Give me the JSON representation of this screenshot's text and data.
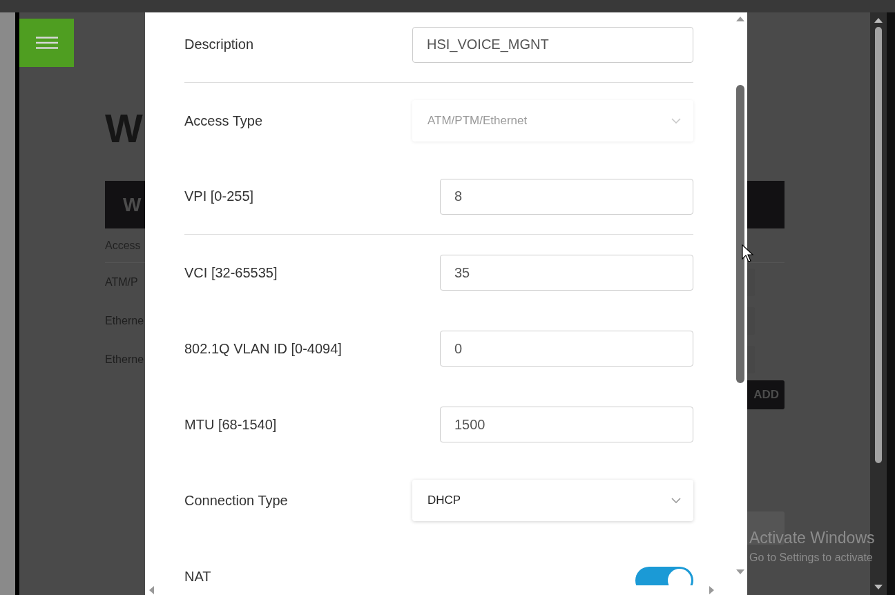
{
  "background_page": {
    "title": "W",
    "panel_title": "W",
    "table": {
      "header": "Access",
      "rows": [
        "ATM/P",
        "Etherne",
        "Etherne"
      ]
    },
    "add_button": "ADD"
  },
  "modal": {
    "fields": [
      {
        "kind": "text",
        "label": "Description",
        "value": "HSI_VOICE_MGNT",
        "divider_after": true
      },
      {
        "kind": "select",
        "label": "Access Type",
        "value": "ATM/PTM/Ethernet",
        "disabled": true,
        "divider_after": false
      },
      {
        "kind": "number",
        "label": "VPI [0-255]",
        "value": "8",
        "divider_after": true
      },
      {
        "kind": "number",
        "label": "VCI [32-65535]",
        "value": "35",
        "divider_after": false
      },
      {
        "kind": "number",
        "label": "802.1Q VLAN ID [0-4094]",
        "value": "0",
        "divider_after": false
      },
      {
        "kind": "number",
        "label": "MTU [68-1540]",
        "value": "1500",
        "divider_after": false
      },
      {
        "kind": "select",
        "label": "Connection Type",
        "value": "DHCP",
        "disabled": false,
        "divider_after": false
      },
      {
        "kind": "toggle",
        "label": "NAT",
        "on": true,
        "divider_after": false
      }
    ]
  },
  "os_notice": {
    "title": "Activate Windows",
    "subtitle": "Go to Settings to activate"
  }
}
